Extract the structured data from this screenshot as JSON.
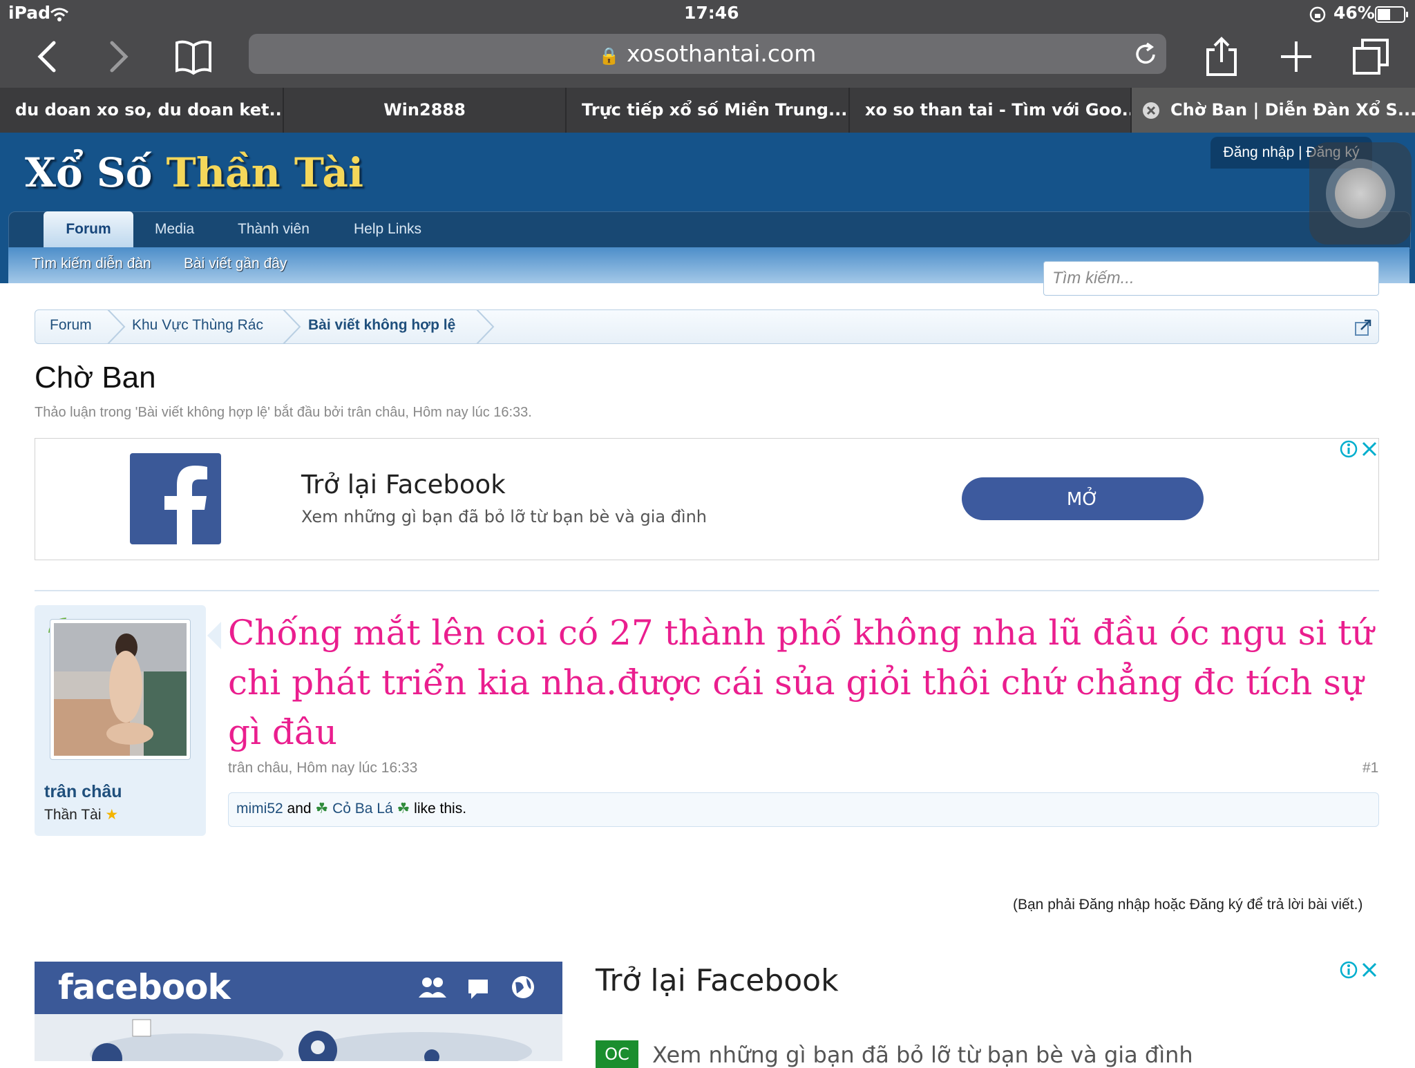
{
  "status_bar": {
    "device": "iPad",
    "time": "17:46",
    "battery": "46%"
  },
  "browser": {
    "url": "xosothantai.com",
    "tabs": [
      {
        "label": "du doan xo so, du doan ket..."
      },
      {
        "label": "Win2888"
      },
      {
        "label": "Trực tiếp xổ số Miền Trung..."
      },
      {
        "label": "xo so than tai - Tìm với Goo..."
      },
      {
        "label": "Chờ Ban | Diễn Đàn Xổ S..."
      }
    ]
  },
  "site": {
    "logo_white": "Xổ Số",
    "logo_gold": "Thần Tài",
    "login_register": "Đăng nhập | Đăng ký",
    "nav": [
      {
        "label": "Forum"
      },
      {
        "label": "Media"
      },
      {
        "label": "Thành viên"
      },
      {
        "label": "Help Links"
      }
    ],
    "subnav": [
      {
        "label": "Tìm kiếm diễn đàn"
      },
      {
        "label": "Bài viết gần đây"
      }
    ],
    "search_placeholder": "Tìm kiếm..."
  },
  "breadcrumbs": [
    {
      "label": "Forum"
    },
    {
      "label": "Khu Vực Thùng Rác"
    },
    {
      "label": "Bài viết không hợp lệ"
    }
  ],
  "thread": {
    "title": "Chờ Ban",
    "description": "Thảo luận trong 'Bài viết không hợp lệ' bắt đầu bởi trân châu, Hôm nay lúc 16:33."
  },
  "ad_top": {
    "title": "Trở lại Facebook",
    "subtitle": "Xem những gì bạn đã bỏ lỡ từ bạn bè và gia đình",
    "button": "MỞ"
  },
  "post": {
    "username": "trân châu",
    "user_title": "Thần Tài",
    "text": "Chống mắt lên coi có 27 thành phố không nha lũ đầu óc ngu si tứ chi phát triển kia nha.được cái sủa giỏi thôi chứ chẳng đc tích sự gì đâu",
    "meta": "trân châu, Hôm nay lúc 16:33",
    "number": "#1",
    "likes": {
      "user1": "mimi52",
      "and": "and",
      "user2": "Cỏ Ba Lá",
      "suffix": "like this."
    }
  },
  "reply_note": "(Bạn phải Đăng nhập hoặc Đăng ký để trả lời bài viết.)",
  "ad_bottom": {
    "brand": "facebook",
    "title": "Trở lại Facebook",
    "badge": "OC",
    "subtitle": "Xem những gì bạn đã bỏ lỡ từ bạn bè và gia đình"
  },
  "colors": {
    "accent": "#15538a",
    "post_text": "#ea1e8e",
    "facebook": "#3b5998"
  }
}
